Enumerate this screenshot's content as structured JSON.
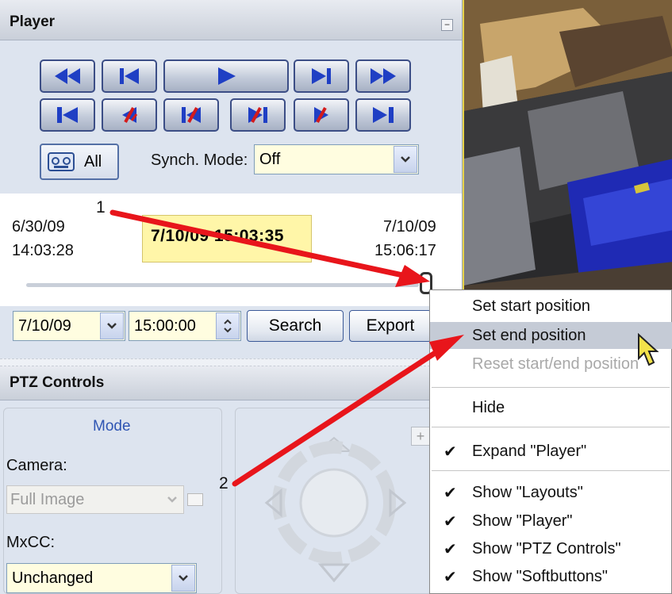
{
  "player": {
    "title": "Player",
    "collapse_icon": "−",
    "transport_row1": [
      "rewind",
      "skip-to-start",
      "play",
      "skip-to-end",
      "fast-forward"
    ],
    "transport_row2": [
      "first-frame",
      "prev-sequence",
      "prev-event",
      "next-event",
      "next-sequence",
      "last-frame"
    ],
    "all_label": "All",
    "sync_mode_label": "Synch. Mode:",
    "sync_mode_value": "Off",
    "start_date": "6/30/09",
    "start_time": "14:03:28",
    "current_time": "7/10/09 15:03:35",
    "end_date": "7/10/09",
    "end_time": "15:06:17",
    "search_date": "7/10/09",
    "search_time": "15:00:00",
    "search_label": "Search",
    "export_label": "Export"
  },
  "ptz": {
    "title": "PTZ Controls",
    "mode_label": "Mode",
    "camera_label": "Camera:",
    "camera_value": "Full Image",
    "mxcc_label": "MxCC:",
    "mxcc_value": "Unchanged"
  },
  "context_menu": {
    "items": [
      {
        "label": "Set start position",
        "checked": false,
        "disabled": false,
        "highlighted": false
      },
      {
        "label": "Set end position",
        "checked": false,
        "disabled": false,
        "highlighted": true
      },
      {
        "label": "Reset start/end position",
        "checked": false,
        "disabled": true,
        "highlighted": false
      },
      {
        "label": "Hide",
        "checked": false,
        "disabled": false,
        "highlighted": false
      },
      {
        "label": "Expand \"Player\"",
        "checked": true,
        "disabled": false,
        "highlighted": false
      },
      {
        "label": "Show \"Layouts\"",
        "checked": true,
        "disabled": false,
        "highlighted": false
      },
      {
        "label": "Show \"Player\"",
        "checked": true,
        "disabled": false,
        "highlighted": false
      },
      {
        "label": "Show \"PTZ Controls\"",
        "checked": true,
        "disabled": false,
        "highlighted": false
      },
      {
        "label": "Show \"Softbuttons\"",
        "checked": true,
        "disabled": false,
        "highlighted": false
      }
    ],
    "check_glyph": "✔"
  },
  "annotations": {
    "callout_1": "1",
    "callout_2": "2",
    "arrow_color": "#e8151b"
  },
  "colors": {
    "panel_bg": "#dde4ef",
    "button_border": "#3c4e86",
    "icon_blue": "#1f3fc4",
    "icon_red": "#d41b1b",
    "current_time_bg": "#fff6a8",
    "menu_highlight": "#c5cbd6"
  }
}
